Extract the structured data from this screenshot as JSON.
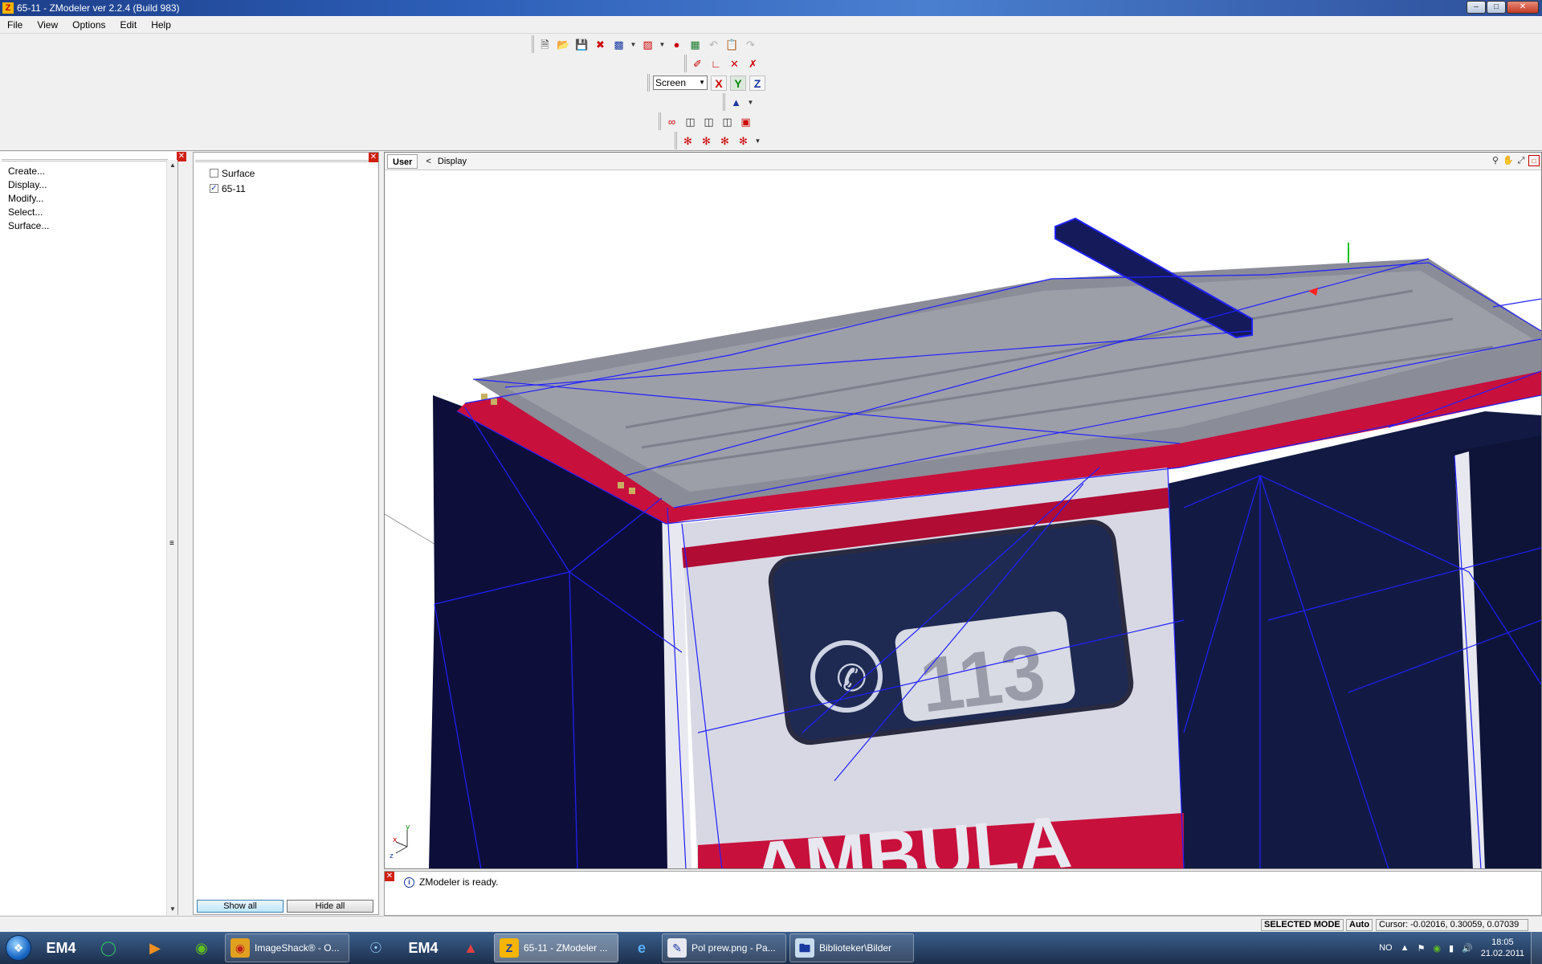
{
  "window": {
    "title": "65-11 - ZModeler ver 2.2.4 (Build 983)",
    "app_icon": "Z"
  },
  "menu": [
    "File",
    "View",
    "Options",
    "Edit",
    "Help"
  ],
  "toolbar": {
    "coord_system": "Screen",
    "axis_x": "X",
    "axis_y": "Y",
    "axis_z": "Z"
  },
  "commands": [
    "Create...",
    "Display...",
    "Modify...",
    "Select...",
    "Surface..."
  ],
  "objects": [
    {
      "label": "Surface",
      "checked": false
    },
    {
      "label": "65-11",
      "checked": true
    }
  ],
  "object_buttons": {
    "show_all": "Show all",
    "hide_all": "Hide all"
  },
  "viewport": {
    "tab": "User",
    "crumb_arrow": "<",
    "crumb": "Display",
    "scene_text_1": "113",
    "scene_text_2": "AMBULA",
    "axis_labels": {
      "x": "x",
      "y": "y",
      "z": "z"
    }
  },
  "log": {
    "message": "ZModeler is ready."
  },
  "status": {
    "mode": "SELECTED MODE",
    "auto": "Auto",
    "cursor": "Cursor: -0.02016, 0.30059, 0.07039"
  },
  "taskbar": {
    "pins": [
      "EM4",
      "EM4"
    ],
    "items": [
      {
        "label": "ImageShack® - O...",
        "icon": "chrome-icon"
      },
      {
        "label": "65-11 - ZModeler ...",
        "icon": "zmodeler-icon"
      },
      {
        "label": "Pol prew.png - Pa...",
        "icon": "paint-icon"
      },
      {
        "label": "Biblioteker\\Bilder",
        "icon": "explorer-icon"
      }
    ],
    "language": "NO",
    "time": "18:05",
    "date": "21.02.2011"
  },
  "colors": {
    "titlebar": "#2d5fb8",
    "wire": "#1a1aff",
    "accent_red": "#c8103c"
  }
}
